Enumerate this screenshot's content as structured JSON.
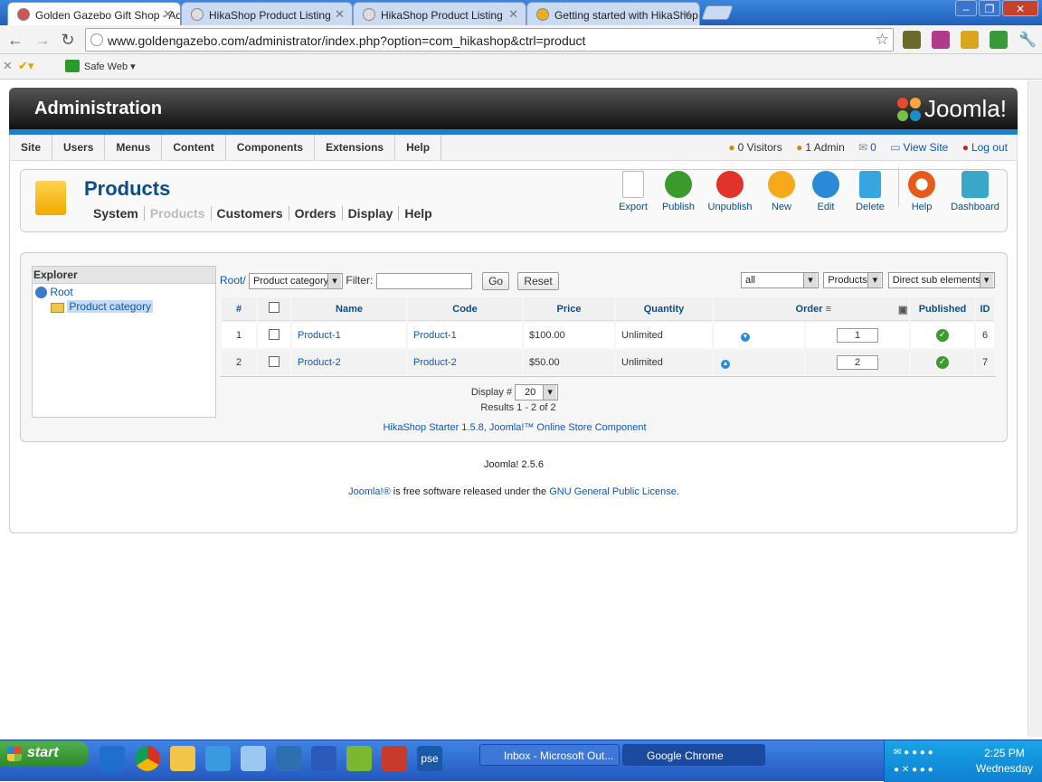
{
  "browser": {
    "tabs": [
      {
        "title": "Golden Gazebo Gift Shop - Ad",
        "active": true
      },
      {
        "title": "HikaShop Product Listing",
        "active": false
      },
      {
        "title": "HikaShop Product Listing",
        "active": false
      },
      {
        "title": "Getting started with HikaShop",
        "active": false
      }
    ],
    "url": "www.goldengazebo.com/administrator/index.php?option=com_hikashop&ctrl=product",
    "bookmark": "Safe Web"
  },
  "admin": {
    "header_title": "Administration",
    "logo_text": "Joomla!",
    "menu": [
      "Site",
      "Users",
      "Menus",
      "Content",
      "Components",
      "Extensions",
      "Help"
    ],
    "status": {
      "visitors": "0 Visitors",
      "admin": "1 Admin",
      "messages": "0",
      "view_site": "View Site",
      "logout": "Log out"
    }
  },
  "component": {
    "title": "Products",
    "submenu": [
      "System",
      "Products",
      "Customers",
      "Orders",
      "Display",
      "Help"
    ],
    "toolbar": [
      "Export",
      "Publish",
      "Unpublish",
      "New",
      "Edit",
      "Delete",
      "Help",
      "Dashboard"
    ]
  },
  "explorer": {
    "heading": "Explorer",
    "root": "Root",
    "category": "Product category"
  },
  "filters": {
    "breadcrumb": "Root/",
    "category_select": "Product category",
    "filter_label": "Filter:",
    "go": "Go",
    "reset": "Reset",
    "all_select": "all",
    "products_select": "Products",
    "sub_select": "Direct sub elements"
  },
  "table": {
    "headers": [
      "#",
      "",
      "Name",
      "Code",
      "Price",
      "Quantity",
      "Order",
      "",
      "Published",
      "ID"
    ],
    "rows": [
      {
        "num": "1",
        "name": "Product-1",
        "code": "Product-1",
        "price": "$100.00",
        "quantity": "Unlimited",
        "order": "1",
        "id": "6"
      },
      {
        "num": "2",
        "name": "Product-2",
        "code": "Product-2",
        "price": "$50.00",
        "quantity": "Unlimited",
        "order": "2",
        "id": "7"
      }
    ]
  },
  "pagination": {
    "display_label": "Display #",
    "display_value": "20",
    "results": "Results 1 - 2 of 2"
  },
  "credits": {
    "hikashop": "HikaShop Starter 1.5.8, Joomla!™ Online Store Component",
    "version": "Joomla! 2.5.6",
    "license_a": "Joomla!®",
    "license_b": " is free software released under the ",
    "license_c": "GNU General Public License",
    "license_d": "."
  },
  "taskbar": {
    "start": "start",
    "tasks": [
      "Inbox - Microsoft Out...",
      "Google Chrome"
    ],
    "time": "2:25 PM",
    "day": "Wednesday"
  }
}
